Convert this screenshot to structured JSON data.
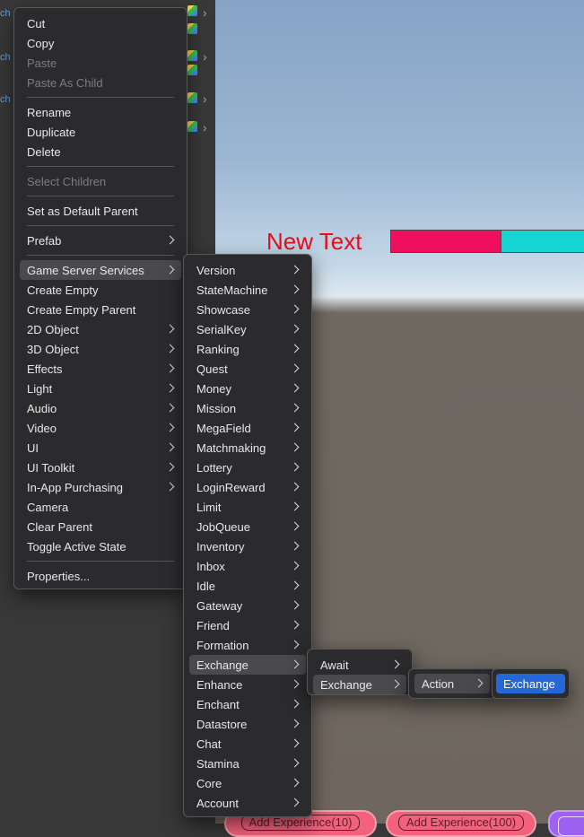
{
  "hierarchy_rows": [
    {
      "label": "ch"
    },
    {
      "label": "ch"
    },
    {
      "label": "ch"
    }
  ],
  "scene": {
    "new_text": "New Text",
    "experience_progress": 0.54,
    "colors": {
      "bar_fill": "#ef0f5e",
      "bar_bg": "#16d4d2",
      "new_text": "#e3101c"
    },
    "buttons": [
      "Add Experience(10)",
      "Add Experience(100)"
    ]
  },
  "context_menu": {
    "items": [
      {
        "label": "Cut",
        "enabled": true,
        "submenu": false
      },
      {
        "label": "Copy",
        "enabled": true,
        "submenu": false
      },
      {
        "label": "Paste",
        "enabled": false,
        "submenu": false
      },
      {
        "label": "Paste As Child",
        "enabled": false,
        "submenu": false
      },
      {
        "label": "Rename",
        "enabled": true,
        "submenu": false
      },
      {
        "label": "Duplicate",
        "enabled": true,
        "submenu": false
      },
      {
        "label": "Delete",
        "enabled": true,
        "submenu": false
      },
      {
        "label": "Select Children",
        "enabled": false,
        "submenu": false
      },
      {
        "label": "Set as Default Parent",
        "enabled": true,
        "submenu": false
      },
      {
        "label": "Prefab",
        "enabled": true,
        "submenu": true
      },
      {
        "label": "Game Server Services",
        "enabled": true,
        "submenu": true
      },
      {
        "label": "Create Empty",
        "enabled": true,
        "submenu": false
      },
      {
        "label": "Create Empty Parent",
        "enabled": true,
        "submenu": false
      },
      {
        "label": "2D Object",
        "enabled": true,
        "submenu": true
      },
      {
        "label": "3D Object",
        "enabled": true,
        "submenu": true
      },
      {
        "label": "Effects",
        "enabled": true,
        "submenu": true
      },
      {
        "label": "Light",
        "enabled": true,
        "submenu": true
      },
      {
        "label": "Audio",
        "enabled": true,
        "submenu": true
      },
      {
        "label": "Video",
        "enabled": true,
        "submenu": true
      },
      {
        "label": "UI",
        "enabled": true,
        "submenu": true
      },
      {
        "label": "UI Toolkit",
        "enabled": true,
        "submenu": true
      },
      {
        "label": "In-App Purchasing",
        "enabled": true,
        "submenu": true
      },
      {
        "label": "Camera",
        "enabled": true,
        "submenu": false
      },
      {
        "label": "Clear Parent",
        "enabled": true,
        "submenu": false
      },
      {
        "label": "Toggle Active State",
        "enabled": true,
        "submenu": false
      },
      {
        "label": "Properties...",
        "enabled": true,
        "submenu": false
      }
    ]
  },
  "gss_menu": {
    "items": [
      "Version",
      "StateMachine",
      "Showcase",
      "SerialKey",
      "Ranking",
      "Quest",
      "Money",
      "Mission",
      "MegaField",
      "Matchmaking",
      "Lottery",
      "LoginReward",
      "Limit",
      "JobQueue",
      "Inventory",
      "Inbox",
      "Idle",
      "Gateway",
      "Friend",
      "Formation",
      "Exchange",
      "Enhance",
      "Enchant",
      "Datastore",
      "Chat",
      "Stamina",
      "Core",
      "Account"
    ]
  },
  "exchange_menu": {
    "items": [
      "Await",
      "Exchange"
    ]
  },
  "exchange_sub_menu": {
    "items": [
      "Action"
    ]
  },
  "action_menu": {
    "items": [
      "Exchange"
    ]
  },
  "colors": {
    "selected": "#2567d6",
    "hover": "#4a4a4d",
    "menu_bg": "#2b2b2d"
  }
}
